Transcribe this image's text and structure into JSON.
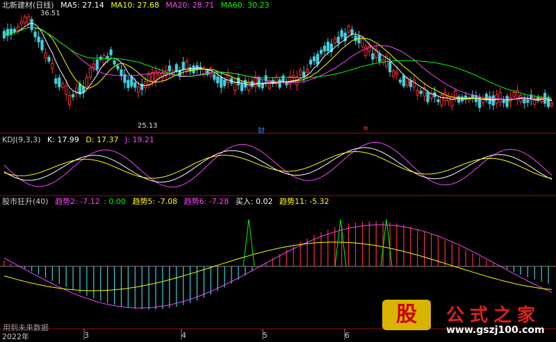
{
  "main_panel": {
    "title": "北新建材(日线)",
    "indicators": [
      {
        "label": "MA5: 27.14",
        "color": "#ffffff"
      },
      {
        "label": "MA10: 27.68",
        "color": "#ffff00"
      },
      {
        "label": "MA20: 28.71",
        "color": "#ff44ff"
      },
      {
        "label": "MA60: 30.23",
        "color": "#00ff00"
      }
    ],
    "high_annotation": "36.51",
    "low_annotation": "25.13",
    "markers": [
      {
        "text": "财",
        "color": "#3a7cff"
      },
      {
        "text": "≡",
        "color": "#ff3030"
      }
    ]
  },
  "kdj_panel": {
    "title": "KDJ(9,3,3)",
    "values": [
      {
        "label": "K: 17.99",
        "color": "#ffffff"
      },
      {
        "label": "D: 17.37",
        "color": "#ffff00"
      },
      {
        "label": "J: 19.21",
        "color": "#ff44ff"
      }
    ]
  },
  "gszs_panel": {
    "title": "股市狂升(40)",
    "values": [
      {
        "label": "趋势2: -7.12",
        "color": "#ff44ff"
      },
      {
        "label": ": 0.00",
        "color": "#00ff00"
      },
      {
        "label": "趋势5: -7.08",
        "color": "#ffff00"
      },
      {
        "label": "趋势6: -7.28",
        "color": "#ff44ff"
      },
      {
        "label": "买入: 0.02",
        "color": "#ffffff"
      },
      {
        "label": "趋势11: -5.32",
        "color": "#ffff00"
      }
    ]
  },
  "bottom": {
    "future_data": "用到未来数据",
    "axis_labels": [
      "2022年",
      "3",
      "4",
      "5",
      "6"
    ]
  },
  "watermark": {
    "logo_char": "股",
    "title": "公式之家",
    "url": "www.gszj100.com"
  },
  "colors": {
    "up": "#ff3030",
    "down": "#40d0e0",
    "panel_border": "#a01010"
  }
}
